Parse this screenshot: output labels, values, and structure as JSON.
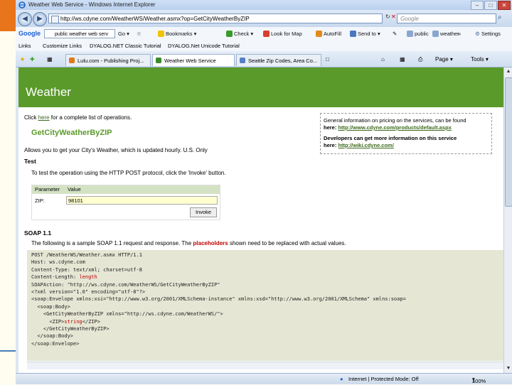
{
  "window": {
    "title": "Weather Web Service - Windows Internet Explorer",
    "buttons": [
      "–",
      "□",
      "✕"
    ]
  },
  "address": {
    "url": "http://ws.cdyne.com/WeatherWS/Weather.asmx?op=GetCityWeatherByZIP",
    "search_placeholder": "Google"
  },
  "google_toolbar": {
    "logo": "Google",
    "query": "public weather web serv",
    "go_label": "Go",
    "bookmarks": "Bookmarks",
    "check": "Check",
    "look_for_map": "Look for Map",
    "autofill": "AutoFill",
    "send_to": "Send to",
    "term1": "public",
    "term2": "weather",
    "more": "»",
    "settings": "Settings"
  },
  "links_bar": {
    "links": [
      "Links",
      "Customize Links",
      "DYALOG.NET Classic Tutorial",
      "DYALOG.Net Unicode Tutorial"
    ]
  },
  "tabs": [
    {
      "label": "Lulu.com - Publishing Proj...",
      "active": false
    },
    {
      "label": "Weather Web Service",
      "active": true
    },
    {
      "label": "Seattle Zip Codes, Area Co...",
      "active": false
    }
  ],
  "command_bar": {
    "page": "Page",
    "tools": "Tools"
  },
  "page": {
    "banner_title": "Weather",
    "click_prefix": "Click ",
    "click_link": "here",
    "click_suffix": " for a complete list of operations.",
    "operation": "GetCityWeatherByZIP",
    "description": "Allows you to get your City's Weather, which is updated hourly. U.S. Only",
    "info_line1": "General information on pricing on the services, can be found",
    "info_line2_prefix": "here: ",
    "info_line2_link": "http://www.cdyne.com/products/default.aspx",
    "info_line3": "Developers can get more information on this service",
    "info_line4_prefix": "here: ",
    "info_line4_link": "http://wiki.cdyne.com/",
    "test_heading": "Test",
    "test_text": "To test the operation using the HTTP POST protocol, click the 'Invoke' button.",
    "param_header": "Parameter",
    "value_header": "Value",
    "param_name": "ZIP:",
    "param_value": "98101",
    "invoke_label": "Invoke",
    "soap_heading": "SOAP 1.1",
    "soap_text_prefix": "The following is a sample SOAP 1.1 request and response.  The ",
    "soap_text_hl": "placeholders",
    "soap_text_suffix": " shown need to be replaced with actual values.",
    "code_lines": [
      "POST /WeatherWS/Weather.asmx HTTP/1.1",
      "Host: ws.cdyne.com",
      "Content-Type: text/xml; charset=utf-8",
      "Content-Length: ",
      "SOAPAction: \"http://ws.cdyne.com/WeatherWS/GetCityWeatherByZIP\"",
      "",
      "<?xml version=\"1.0\" encoding=\"utf-8\"?>",
      "<soap:Envelope xmlns:xsi=\"http://www.w3.org/2001/XMLSchema-instance\" xmlns:xsd=\"http://www.w3.org/2001/XMLSchema\" xmlns:soap=",
      "  <soap:Body>",
      "    <GetCityWeatherByZIP xmlns=\"http://ws.cdyne.com/WeatherWS/\">",
      "      <ZIP>",
      "    </GetCityWeatherByZIP>",
      "  </soap:Body>",
      "</soap:Envelope>"
    ],
    "code_hl_length": "length",
    "code_hl_string": "string",
    "code_zip_close": "</ZIP>"
  },
  "status": {
    "zone": "Internet | Protected Mode: Off",
    "zoom": "100%"
  }
}
